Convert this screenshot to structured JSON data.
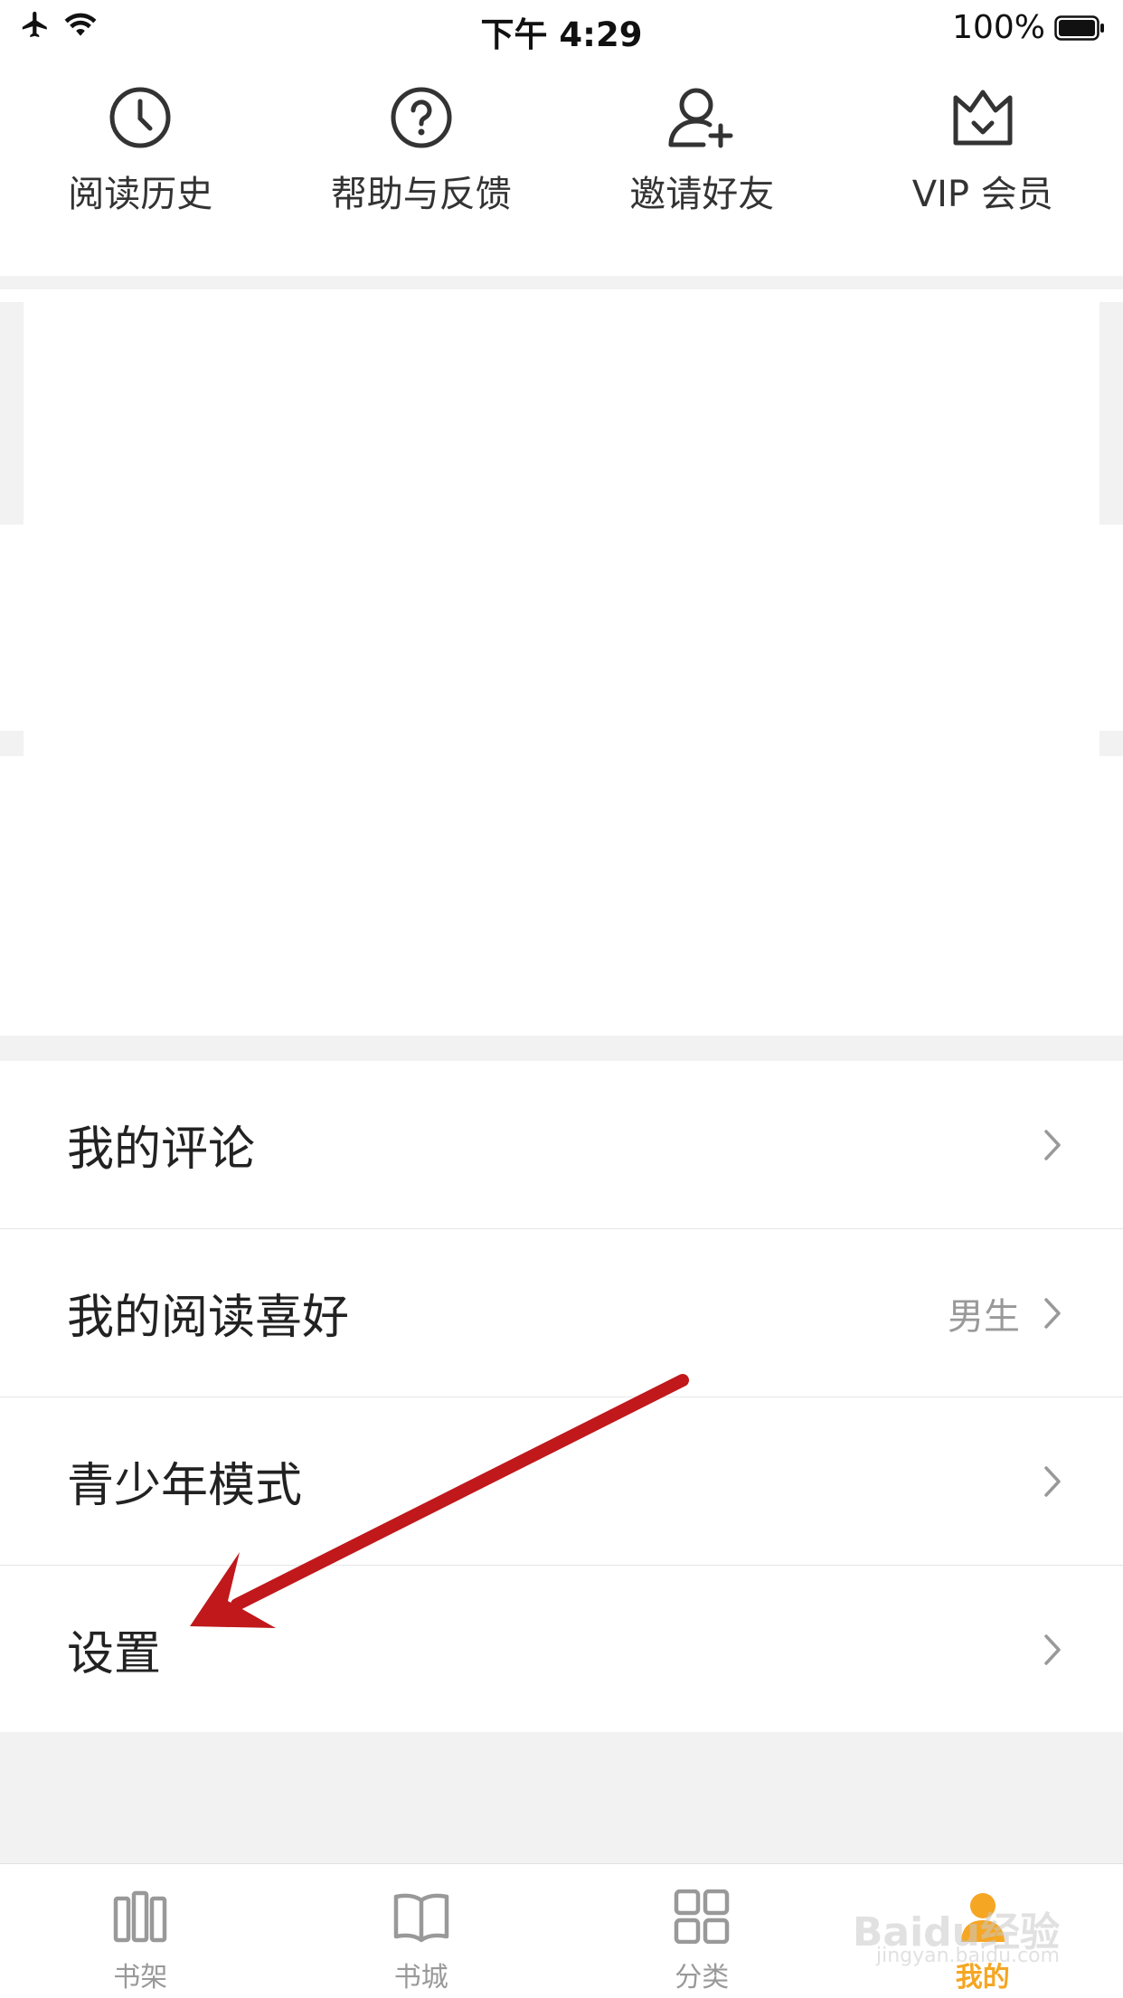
{
  "status_bar": {
    "time": "下午 4:29",
    "battery": "100%"
  },
  "quick_actions": [
    {
      "label": "阅读历史",
      "icon": "clock-icon"
    },
    {
      "label": "帮助与反馈",
      "icon": "question-icon"
    },
    {
      "label": "邀请好友",
      "icon": "add-user-icon"
    },
    {
      "label": "VIP 会员",
      "icon": "crown-icon"
    }
  ],
  "menu": [
    {
      "label": "我的评论",
      "value": ""
    },
    {
      "label": "我的阅读喜好",
      "value": "男生"
    },
    {
      "label": "青少年模式",
      "value": ""
    },
    {
      "label": "设置",
      "value": ""
    }
  ],
  "tabs": [
    {
      "label": "书架",
      "icon": "bookshelf-icon",
      "active": false
    },
    {
      "label": "书城",
      "icon": "book-icon",
      "active": false
    },
    {
      "label": "分类",
      "icon": "grid-icon",
      "active": false
    },
    {
      "label": "我的",
      "icon": "profile-icon",
      "active": true
    }
  ],
  "watermark": {
    "brand": "Baidu经验",
    "url": "jingyan.baidu.com"
  },
  "colors": {
    "accent": "#f5a623",
    "annotation_arrow": "#c0181b"
  }
}
